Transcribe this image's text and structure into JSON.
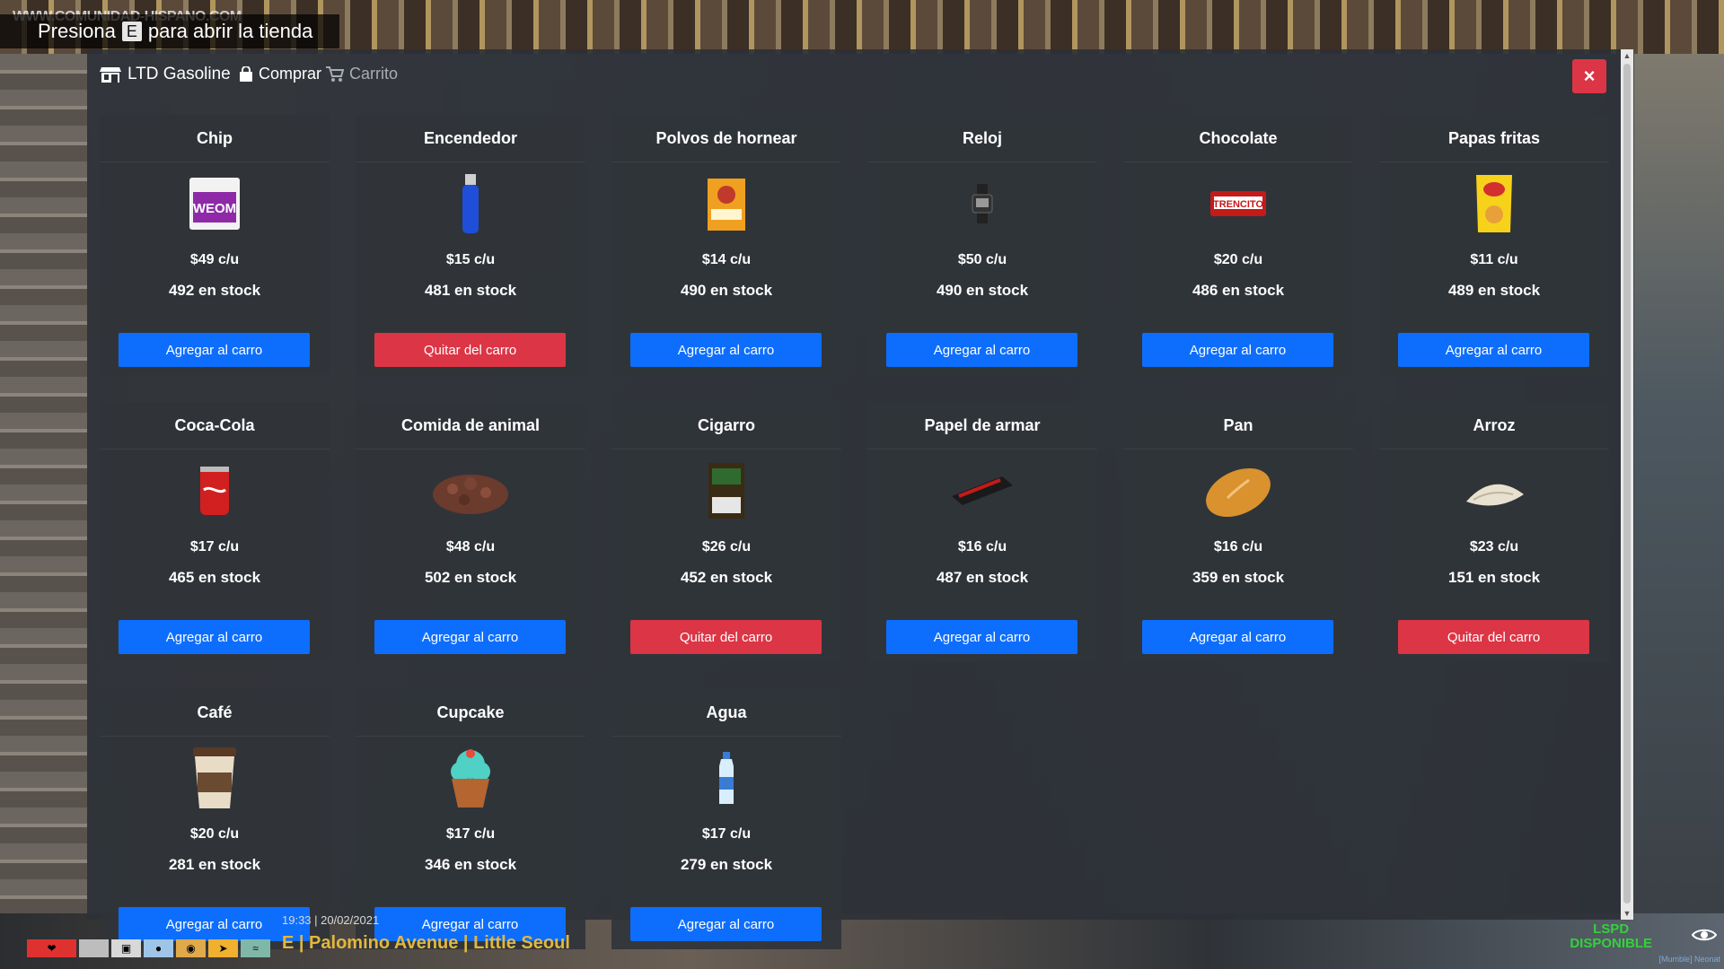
{
  "hint": {
    "prefix": "Presiona",
    "key": "E",
    "suffix": "para abrir la tienda"
  },
  "watermark": "WWW.COMUNIDAD-HISPANO.COM",
  "header": {
    "store_name": "LTD Gasoline",
    "tabs": [
      {
        "label": "Comprar",
        "icon": "shopping-bag-icon",
        "active": true
      },
      {
        "label": "Carrito",
        "icon": "cart-icon",
        "active": false
      }
    ],
    "close_label": "×"
  },
  "colors": {
    "add": "#0d6efd",
    "remove": "#dc3545",
    "panel": "#2c3036",
    "location": "#e3b73c",
    "status": "#33d13d"
  },
  "products": [
    {
      "name": "Chip",
      "price": "$49 c/u",
      "stock": "492 en stock",
      "button": "Agregar al carro",
      "state": "add",
      "icon": "sim-card-icon"
    },
    {
      "name": "Encendedor",
      "price": "$15 c/u",
      "stock": "481 en stock",
      "button": "Quitar del carro",
      "state": "remove",
      "icon": "lighter-icon"
    },
    {
      "name": "Polvos de hornear",
      "price": "$14 c/u",
      "stock": "490 en stock",
      "button": "Agregar al carro",
      "state": "add",
      "icon": "baking-soda-icon"
    },
    {
      "name": "Reloj",
      "price": "$50 c/u",
      "stock": "490 en stock",
      "button": "Agregar al carro",
      "state": "add",
      "icon": "watch-icon"
    },
    {
      "name": "Chocolate",
      "price": "$20 c/u",
      "stock": "486 en stock",
      "button": "Agregar al carro",
      "state": "add",
      "icon": "chocolate-icon"
    },
    {
      "name": "Papas fritas",
      "price": "$11 c/u",
      "stock": "489 en stock",
      "button": "Agregar al carro",
      "state": "add",
      "icon": "chips-bag-icon"
    },
    {
      "name": "Coca-Cola",
      "price": "$17 c/u",
      "stock": "465 en stock",
      "button": "Agregar al carro",
      "state": "add",
      "icon": "soda-can-icon"
    },
    {
      "name": "Comida de animal",
      "price": "$48 c/u",
      "stock": "502 en stock",
      "button": "Agregar al carro",
      "state": "add",
      "icon": "pet-food-icon"
    },
    {
      "name": "Cigarro",
      "price": "$26 c/u",
      "stock": "452 en stock",
      "button": "Quitar del carro",
      "state": "remove",
      "icon": "cigarette-pack-icon"
    },
    {
      "name": "Papel de armar",
      "price": "$16 c/u",
      "stock": "487 en stock",
      "button": "Agregar al carro",
      "state": "add",
      "icon": "rolling-paper-icon"
    },
    {
      "name": "Pan",
      "price": "$16 c/u",
      "stock": "359 en stock",
      "button": "Agregar al carro",
      "state": "add",
      "icon": "bread-icon"
    },
    {
      "name": "Arroz",
      "price": "$23 c/u",
      "stock": "151 en stock",
      "button": "Quitar del carro",
      "state": "remove",
      "icon": "rice-icon"
    },
    {
      "name": "Café",
      "price": "$20 c/u",
      "stock": "281 en stock",
      "button": "Agregar al carro",
      "state": "add",
      "icon": "coffee-cup-icon"
    },
    {
      "name": "Cupcake",
      "price": "$17 c/u",
      "stock": "346 en stock",
      "button": "Agregar al carro",
      "state": "add",
      "icon": "cupcake-icon"
    },
    {
      "name": "Agua",
      "price": "$17 c/u",
      "stock": "279 en stock",
      "button": "Agregar al carro",
      "state": "add",
      "icon": "water-bottle-icon"
    }
  ],
  "hud": {
    "datetime": "19:33 | 20/02/2021",
    "location": "E | Palomino Avenue | Little Seoul",
    "status_line1": "LSPD",
    "status_line2": "DISPONIBLE",
    "user": "[Mumble] Neonat"
  }
}
